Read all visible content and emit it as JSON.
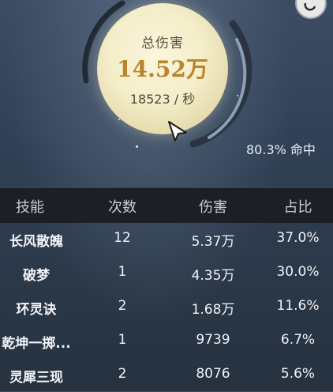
{
  "dial": {
    "label": "总伤害",
    "total": "14.52万",
    "rate": "18523 / 秒"
  },
  "hit_rate": "80.3% 命中",
  "colors": {
    "moon": "#f4edc8",
    "total_text": "#b8862f",
    "header_bg": "#1c1f26",
    "ring": "#6f7f90"
  },
  "icons": {
    "cursor": "arrow-cursor-icon",
    "corner": "refresh-icon"
  },
  "table": {
    "headers": [
      "技能",
      "次数",
      "伤害",
      "占比"
    ],
    "rows": [
      {
        "name": "长风散魄",
        "count": "12",
        "damage": "5.37万",
        "percent": "37.0%"
      },
      {
        "name": "破梦",
        "count": "1",
        "damage": "4.35万",
        "percent": "30.0%"
      },
      {
        "name": "环灵诀",
        "count": "2",
        "damage": "1.68万",
        "percent": "11.6%"
      },
      {
        "name": "乾坤一掷...",
        "count": "1",
        "damage": "9739",
        "percent": "6.7%"
      },
      {
        "name": "灵犀三现",
        "count": "2",
        "damage": "8076",
        "percent": "5.6%"
      }
    ]
  }
}
